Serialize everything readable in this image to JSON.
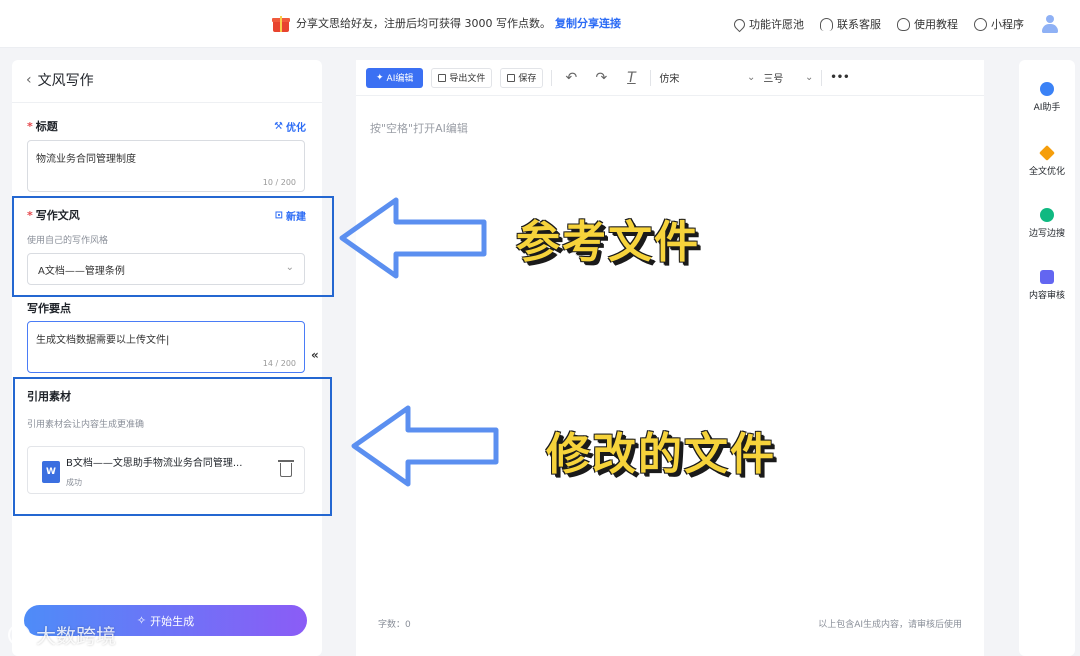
{
  "topbar": {
    "promo_text": "分享文思给好友，注册后均可获得 3000 写作点数。",
    "promo_link": "复制分享连接",
    "nav": [
      "功能许愿池",
      "联系客服",
      "使用教程",
      "小程序"
    ]
  },
  "left_panel": {
    "back_label": "文风写作",
    "title": {
      "label": "标题",
      "action": "优化",
      "value": "物流业务合同管理制度",
      "counter": "10 / 200"
    },
    "style": {
      "label": "写作文风",
      "action": "新建",
      "hint": "使用自己的写作风格",
      "selected": "A文档——管理条例"
    },
    "points": {
      "label": "写作要点",
      "value": "生成文档数据需要以上传文件|",
      "counter": "14 / 200"
    },
    "materials": {
      "label": "引用素材",
      "hint": "引用素材会让内容生成更准确",
      "file_icon": "W",
      "file_name": "B文档——文思助手物流业务合同管理...",
      "file_status": "成功"
    },
    "generate_button": "开始生成",
    "collapse_glyph": "«"
  },
  "editor": {
    "toolbar": {
      "ai_edit": "AI编辑",
      "export": "导出文件",
      "save": "保存",
      "font": "仿宋",
      "size": "三号",
      "more": "•••"
    },
    "placeholder": "按\"空格\"打开AI编辑",
    "word_count": "字数：0",
    "footer_note": "以上包含AI生成内容，请审核后使用"
  },
  "right_sidebar": {
    "tools": [
      {
        "label": "AI助手",
        "color": "#3b82f6"
      },
      {
        "label": "全文优化",
        "color": "#f59e0b"
      },
      {
        "label": "边写边搜",
        "color": "#10b981"
      },
      {
        "label": "内容审核",
        "color": "#6366f1"
      }
    ]
  },
  "annotations": {
    "top": "参考文件",
    "bottom": "修改的文件",
    "box_color": "#2467d1",
    "arrow_color": "#5b8ff0"
  },
  "watermark": "大数跨境"
}
